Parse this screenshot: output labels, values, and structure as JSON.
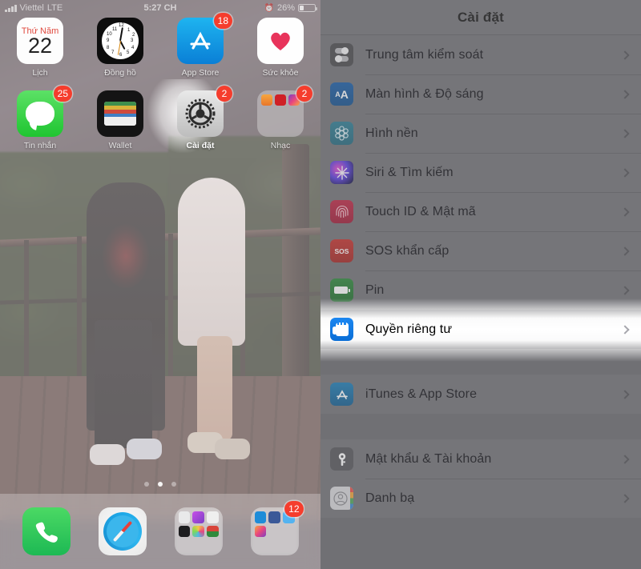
{
  "phone": {
    "status_bar": {
      "carrier": "Viettel",
      "network": "LTE",
      "time": "5:27 CH",
      "battery_percent": "26%",
      "alarm_icon": "alarm-clock-icon"
    },
    "home_screen": {
      "apps": [
        {
          "name": "Lịch",
          "icon": "calendar-icon",
          "weekday": "Thứ Năm",
          "day": "22",
          "badge": null
        },
        {
          "name": "Đồng hồ",
          "icon": "clock-icon",
          "badge": null
        },
        {
          "name": "App Store",
          "icon": "app-store-icon",
          "badge": "18"
        },
        {
          "name": "Sức khỏe",
          "icon": "health-heart-icon",
          "badge": null
        },
        {
          "name": "Tin nhắn",
          "icon": "messages-icon",
          "badge": "25"
        },
        {
          "name": "Wallet",
          "icon": "wallet-icon",
          "badge": null
        },
        {
          "name": "Cài đặt",
          "icon": "settings-gear-icon",
          "badge": "2",
          "highlighted": true
        },
        {
          "name": "Nhạc",
          "icon": "music-folder-icon",
          "badge": "2"
        }
      ],
      "page_dots": {
        "count": 3,
        "active_index": 1
      },
      "dock": [
        {
          "name": "Điện thoại",
          "icon": "phone-icon",
          "badge": null
        },
        {
          "name": "Safari",
          "icon": "safari-compass-icon",
          "badge": null
        },
        {
          "name": "Thư mục ảnh",
          "icon": "photo-folder-icon",
          "badge": null
        },
        {
          "name": "Thư mục mạng xã hội",
          "icon": "social-folder-icon",
          "badge": "12"
        }
      ]
    }
  },
  "settings": {
    "nav": {
      "title": "Cài đặt"
    },
    "groups": [
      {
        "rows": [
          {
            "label": "Trung tâm kiểm soát",
            "icon": "control-center-icon",
            "highlighted": false
          },
          {
            "label": "Màn hình & Độ sáng",
            "icon": "display-brightness-icon",
            "highlighted": false
          },
          {
            "label": "Hình nền",
            "icon": "wallpaper-icon",
            "highlighted": false
          },
          {
            "label": "Siri & Tìm kiếm",
            "icon": "siri-icon",
            "highlighted": false
          },
          {
            "label": "Touch ID & Mật mã",
            "icon": "touch-id-icon",
            "highlighted": false
          },
          {
            "label": "SOS khẩn cấp",
            "icon": "sos-icon",
            "badge_text": "SOS",
            "highlighted": false
          },
          {
            "label": "Pin",
            "icon": "battery-icon",
            "highlighted": false
          },
          {
            "label": "Quyền riêng tư",
            "icon": "privacy-hand-icon",
            "highlighted": true
          }
        ]
      },
      {
        "rows": [
          {
            "label": "iTunes & App Store",
            "icon": "itunes-app-store-icon",
            "highlighted": false
          }
        ]
      },
      {
        "rows": [
          {
            "label": "Mật khẩu & Tài khoản",
            "icon": "passwords-key-icon",
            "highlighted": false
          },
          {
            "label": "Danh bạ",
            "icon": "contacts-icon",
            "highlighted": false
          }
        ]
      }
    ],
    "colors": {
      "list_background": "#757579",
      "panel_background": "#6d6d72",
      "highlight": "#ffffff",
      "text": "#15151a",
      "privacy_icon": "#1b86f0"
    }
  }
}
